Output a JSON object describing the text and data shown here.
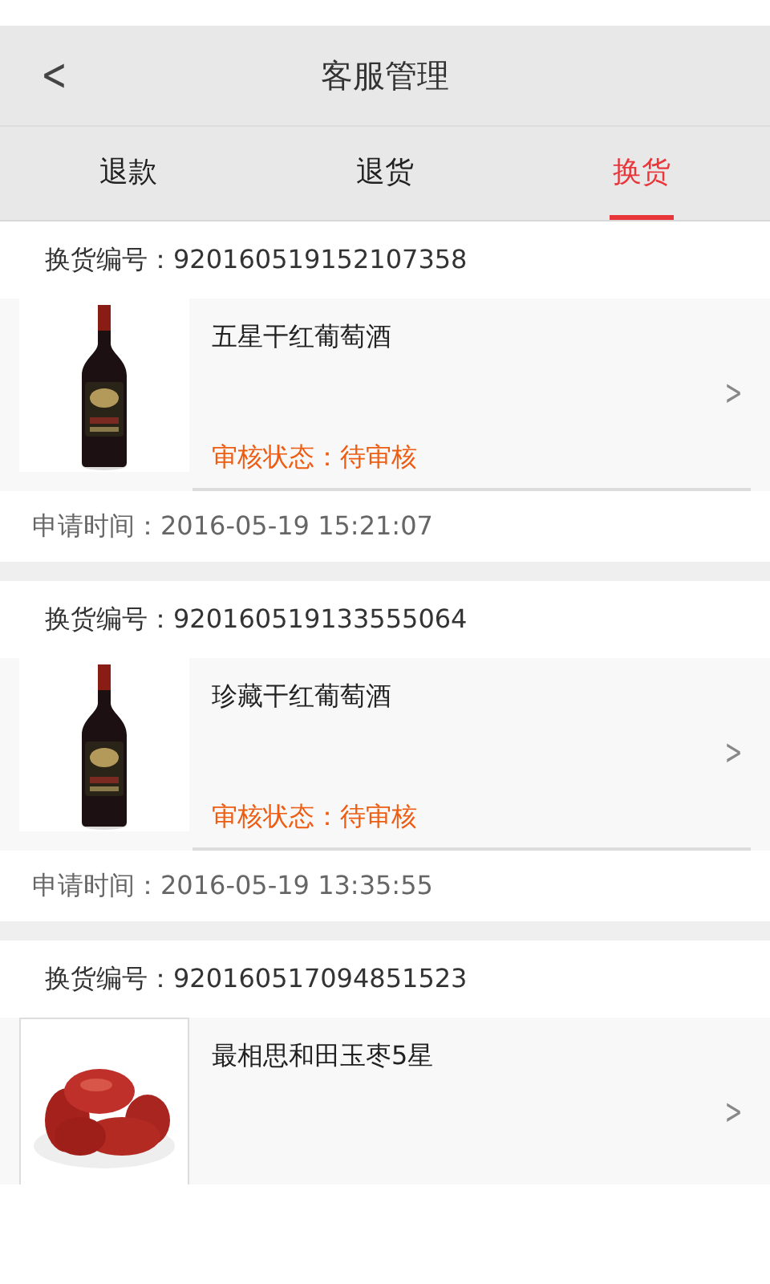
{
  "header": {
    "back": "<",
    "title": "客服管理"
  },
  "tabs": [
    {
      "label": "退款",
      "selected": false
    },
    {
      "label": "退货",
      "selected": false
    },
    {
      "label": "换货",
      "selected": true
    }
  ],
  "orders": [
    {
      "number": "换货编号：920160519152107358",
      "product": "五星干红葡萄酒",
      "status": "审核状态：待审核",
      "time": "申请时间：2016-05-19 15:21:07",
      "arrow": ">"
    },
    {
      "number": "换货编号：920160519133555064",
      "product": "珍藏干红葡萄酒",
      "status": "审核状态：待审核",
      "time": "申请时间：2016-05-19 13:35:55",
      "arrow": ">"
    },
    {
      "number": "换货编号：920160517094851523",
      "product": "最相思和田玉枣5星",
      "arrow": ">"
    }
  ]
}
